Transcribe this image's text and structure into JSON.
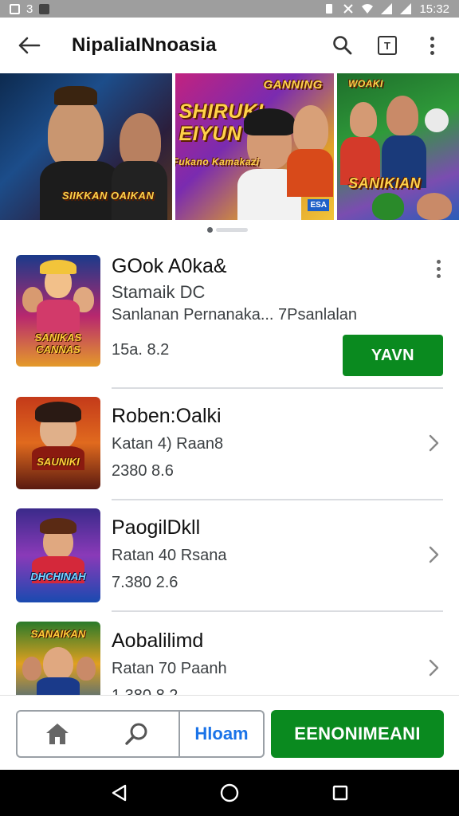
{
  "status_bar": {
    "left_indicator": "3",
    "time": "15:32"
  },
  "app_bar": {
    "title": "NipaliaINnoasia"
  },
  "banners": [
    {
      "headline": "",
      "caption": "SIIKKAN OAIKAN"
    },
    {
      "headline": "SHIRUKI EIYUN",
      "top_logo": "GANNING",
      "caption": "Fukano Kamakazi",
      "badge": "ESA"
    },
    {
      "headline": "SANIKIAN",
      "top_logo": "WOAKI",
      "caption": ""
    }
  ],
  "apps": [
    {
      "title": "GOok A0ka&",
      "developer": "Stamaik DC",
      "description": "Sanlanan  Pernanaka... 7Psanlalan",
      "stats": "15a. 8.2",
      "action_label": "YAVN",
      "thumb_text": "SANIKAS CANNAS",
      "colors": {
        "bg_top": "#1a3a8a",
        "bg_mid": "#b8286e",
        "bg_bottom": "#e49a2a"
      }
    },
    {
      "title": "Roben:Oalki",
      "developer": "Katan 4) Raan8",
      "stats": "2380 8.6",
      "thumb_text": "SAUNIKI",
      "colors": {
        "bg_top": "#c43a1a",
        "bg_mid": "#e06a1e",
        "bg_bottom": "#5a1a10"
      }
    },
    {
      "title": "PaogilDkll",
      "developer": "Ratan 40 Rsana",
      "stats": "7.380 2.6",
      "thumb_text": "DHCHINAH",
      "colors": {
        "bg_top": "#3a2a8a",
        "bg_mid": "#8a3ab8",
        "bg_bottom": "#1a4ab0"
      }
    },
    {
      "title": "Aobalilimd",
      "developer": "Ratan 70 Paanh",
      "stats": "1.380 8.2",
      "thumb_text": "SANAIKAN",
      "colors": {
        "bg_top": "#2a7a2a",
        "bg_mid": "#e0a020",
        "bg_bottom": "#1a5a9a"
      }
    }
  ],
  "bottom_bar": {
    "secondary_label": "Hloam",
    "primary_label": "EENONIMEANI"
  },
  "colors": {
    "accent_green": "#0a8a1f",
    "link_blue": "#1a73e8"
  }
}
